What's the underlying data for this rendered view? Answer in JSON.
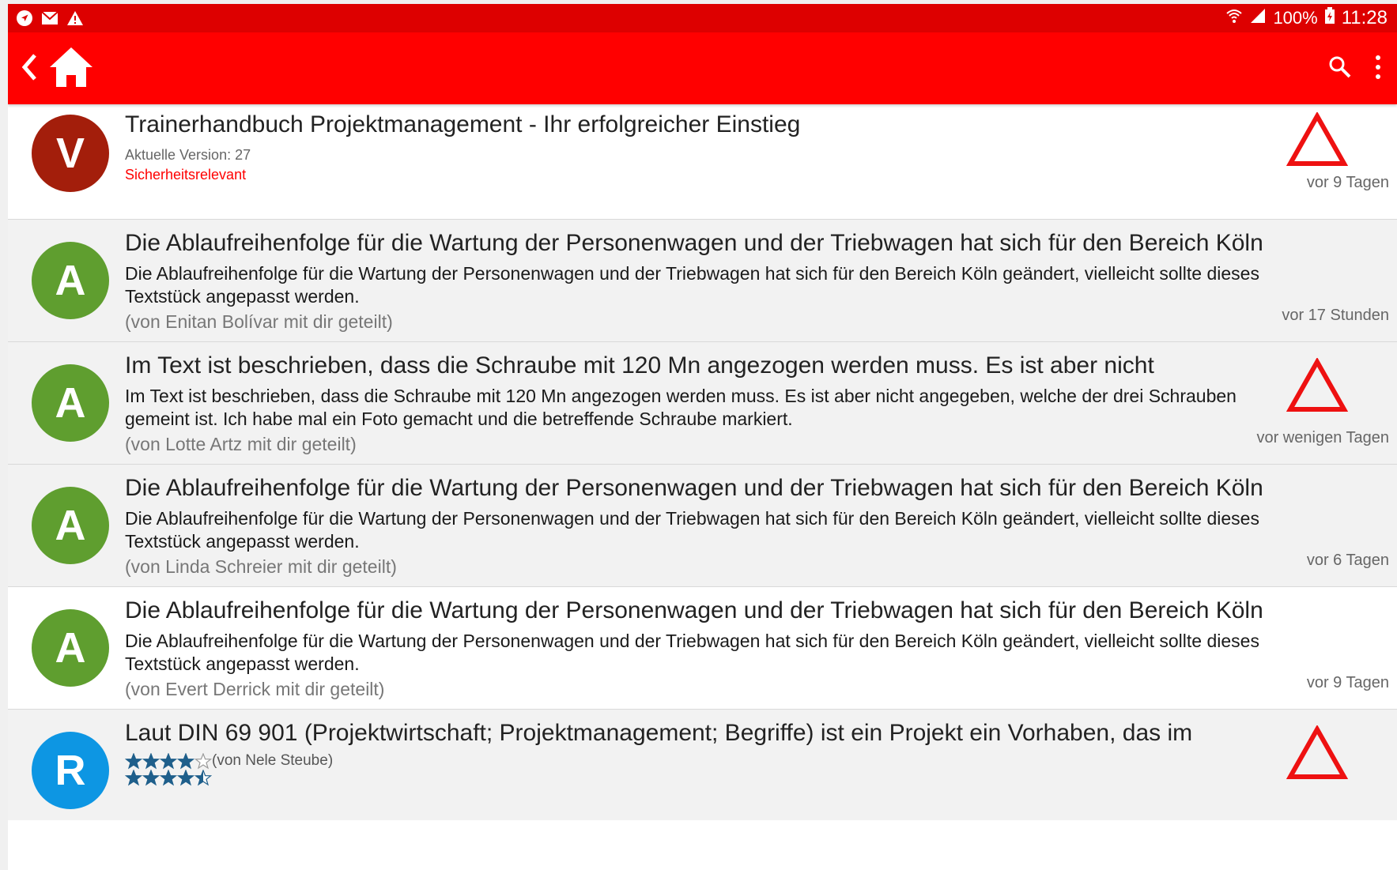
{
  "status_bar": {
    "battery": "100%",
    "time": "11:28",
    "left_icons": [
      "navigation-icon",
      "mail-icon",
      "warning-icon"
    ],
    "right_icons": [
      "wifi-icon",
      "signal-icon",
      "battery-icon"
    ]
  },
  "toolbar": {
    "icons": [
      "back-icon",
      "home-icon",
      "search-icon",
      "more-vert-icon"
    ]
  },
  "colors": {
    "status_bar": "#dd0000",
    "toolbar": "#ff0000",
    "avatar_v": "#a31e0b",
    "avatar_a": "#5f9e2f",
    "avatar_r": "#0d96e3",
    "warning": "#ee1111",
    "safety_text": "#ff0000"
  },
  "items": [
    {
      "avatar_letter": "V",
      "title": "Trainerhandbuch Projektmanagement - Ihr erfolgreicher Einstieg",
      "version": "Aktuelle Version: 27",
      "safety": "Sicherheitsrelevant",
      "time": "vor 9 Tagen",
      "warning": true
    },
    {
      "avatar_letter": "A",
      "title": "Die Ablaufreihenfolge für die Wartung der Personenwagen und der Triebwagen hat sich für den Bereich Köln",
      "body": "Die Ablaufreihenfolge für die Wartung der Personenwagen und der Triebwagen hat sich für den Bereich Köln geändert, vielleicht sollte dieses Textstück angepasst werden.",
      "shared": "(von Enitan Bolívar mit dir geteilt)",
      "time": "vor 17 Stunden",
      "warning": false
    },
    {
      "avatar_letter": "A",
      "title": "Im Text ist beschrieben, dass die Schraube mit 120 Mn angezogen werden muss. Es ist aber nicht",
      "body": "Im Text ist beschrieben, dass die Schraube mit 120 Mn angezogen werden muss. Es ist aber nicht angegeben, welche der drei Schrauben gemeint ist. Ich habe mal ein Foto gemacht und die betreffende Schraube markiert.",
      "shared": "(von Lotte Artz mit dir geteilt)",
      "time": "vor wenigen Tagen",
      "warning": true
    },
    {
      "avatar_letter": "A",
      "title": "Die Ablaufreihenfolge für die Wartung der Personenwagen und der Triebwagen hat sich für den Bereich Köln",
      "body": "Die Ablaufreihenfolge für die Wartung der Personenwagen und der Triebwagen hat sich für den Bereich Köln geändert, vielleicht sollte dieses Textstück angepasst werden.",
      "shared": "(von Linda Schreier mit dir geteilt)",
      "time": "vor 6 Tagen",
      "warning": false
    },
    {
      "avatar_letter": "A",
      "title": "Die Ablaufreihenfolge für die Wartung der Personenwagen und der Triebwagen hat sich für den Bereich Köln",
      "body": "Die Ablaufreihenfolge für die Wartung der Personenwagen und der Triebwagen hat sich für den Bereich Köln geändert, vielleicht sollte dieses Textstück angepasst werden.",
      "shared": "(von Evert Derrick mit dir geteilt)",
      "time": "vor 9 Tagen",
      "warning": false
    },
    {
      "avatar_letter": "R",
      "title": "Laut DIN 69 901 (Projektwirtschaft; Projektmanagement; Begriffe) ist ein Projekt ein Vorhaben, das im",
      "rating_by": "(von Nele Steube)",
      "rating_1": 4,
      "rating_2": 4.5,
      "rating_max": 5,
      "warning": true
    }
  ]
}
